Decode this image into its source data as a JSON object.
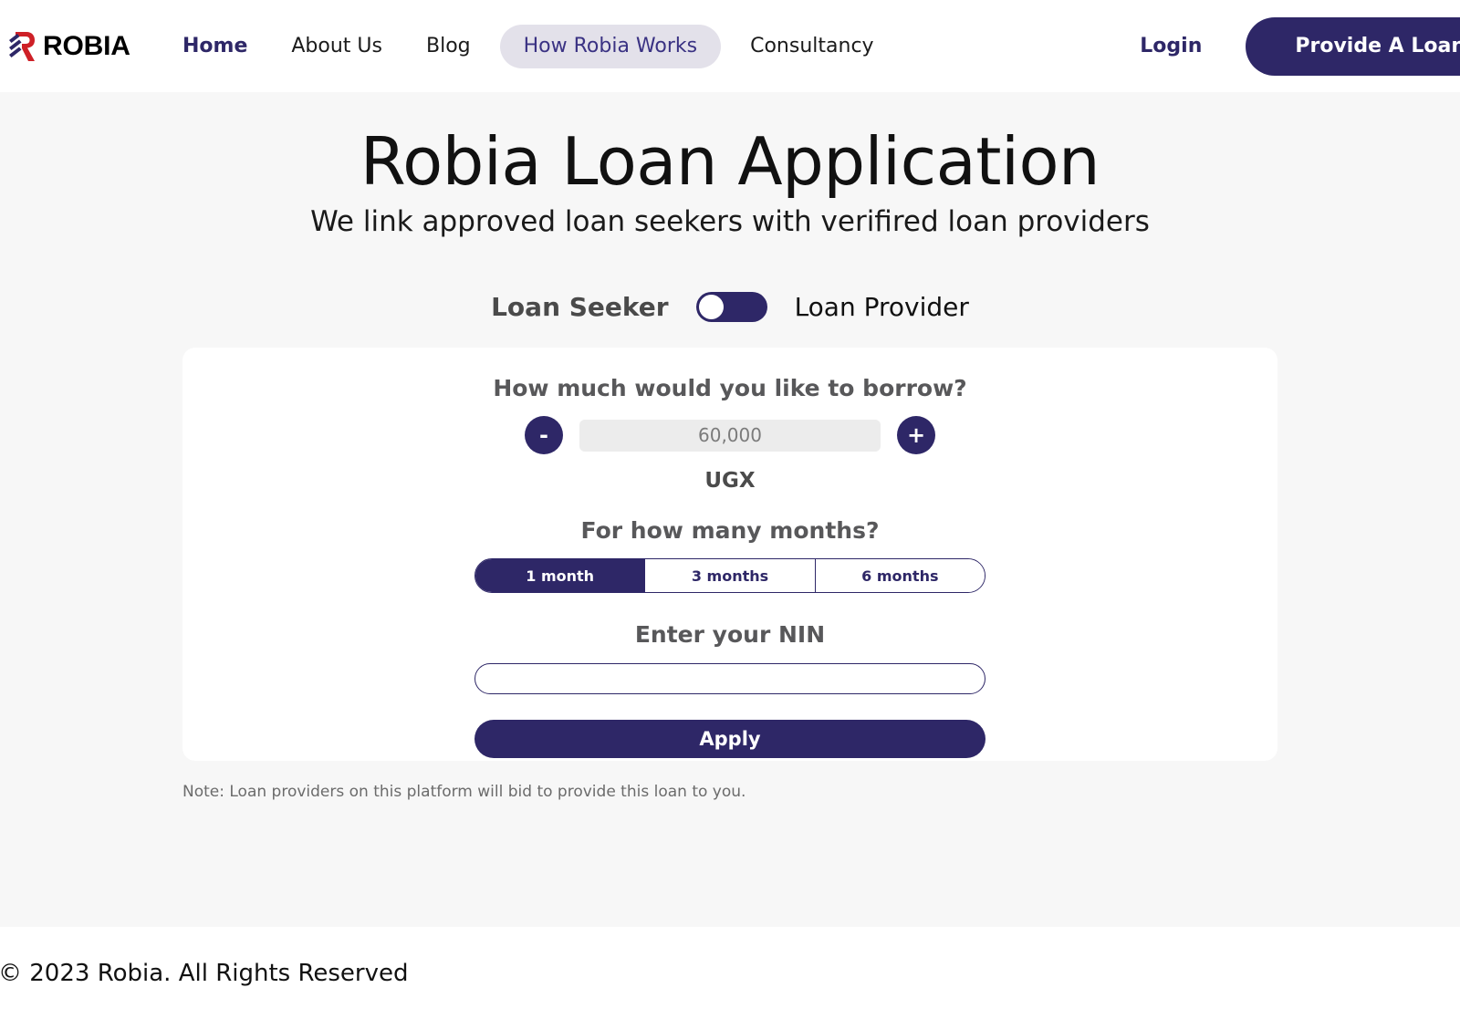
{
  "brand": {
    "name": "ROBIA",
    "logo_icon": "robia-r-logo-icon"
  },
  "nav": {
    "links": [
      {
        "label": "Home",
        "state": "active"
      },
      {
        "label": "About Us",
        "state": "default"
      },
      {
        "label": "Blog",
        "state": "default"
      },
      {
        "label": "How Robia Works",
        "state": "pill-highlight"
      },
      {
        "label": "Consultancy",
        "state": "default"
      }
    ],
    "login_label": "Login",
    "cta_label": "Provide A Loan"
  },
  "hero": {
    "title": "Robia Loan Application",
    "subtitle": "We link approved loan seekers with verifired loan providers"
  },
  "role_toggle": {
    "left_label": "Loan Seeker",
    "right_label": "Loan Provider",
    "selected": "Loan Seeker",
    "knob_position": "left"
  },
  "form": {
    "amount_label": "How much would you like to borrow?",
    "amount_value": "60,000",
    "amount_placeholder": "60,000",
    "decrement_label": "-",
    "increment_label": "+",
    "currency": "UGX",
    "months_label": "For how many months?",
    "months_options": [
      {
        "label": "1 month",
        "selected": true
      },
      {
        "label": "3 months",
        "selected": false
      },
      {
        "label": "6 months",
        "selected": false
      }
    ],
    "nin_label": "Enter your NIN",
    "nin_value": "",
    "nin_placeholder": "",
    "apply_label": "Apply"
  },
  "note": "Note: Loan providers on this platform will bid to provide this loan to you.",
  "footer": {
    "copyright": "© 2023 Robia. All Rights Reserved"
  },
  "colors": {
    "brand_navy": "#2E2767",
    "pill_bg": "#E3E1EA",
    "page_bg": "#F7F7F7",
    "card_bg": "#FFFFFF",
    "logo_red": "#CE2027",
    "logo_navy": "#2E2767",
    "input_bg": "#ECECEC"
  }
}
